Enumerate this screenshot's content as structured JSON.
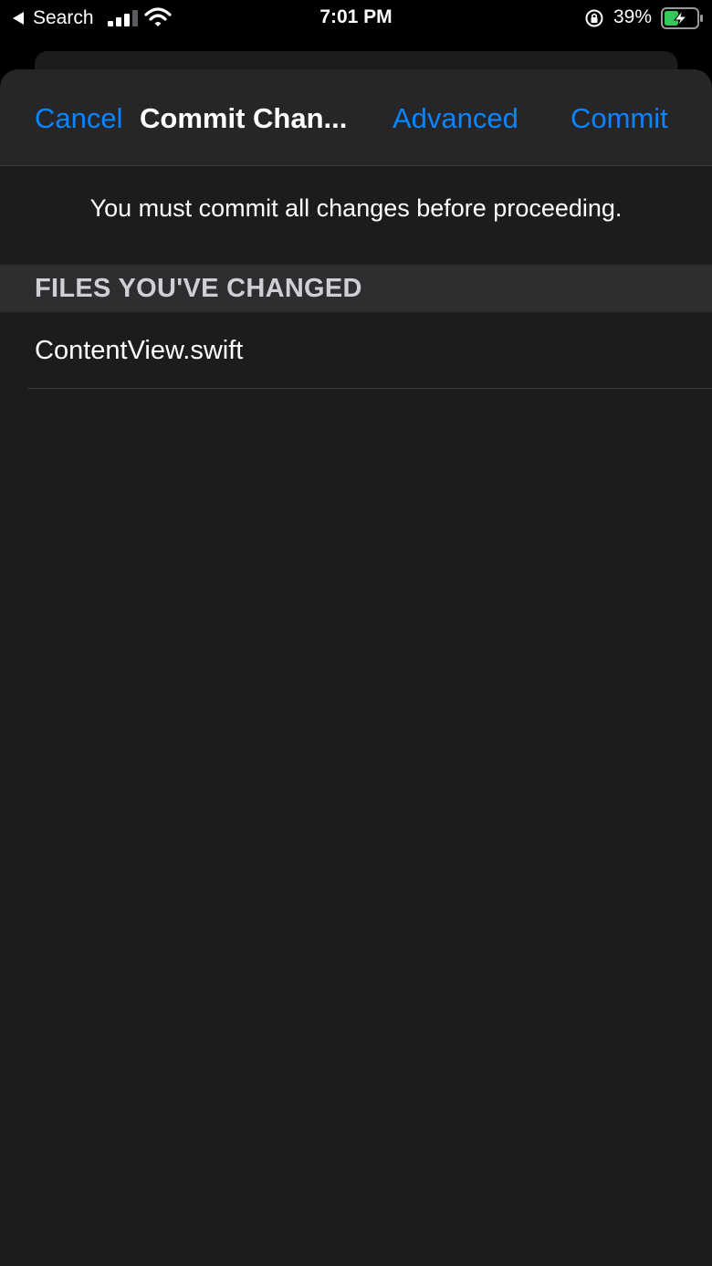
{
  "status_bar": {
    "back_label": "Search",
    "time": "7:01 PM",
    "battery_percent": "39%",
    "icons": [
      "back-triangle-icon",
      "cellular-signal-icon",
      "wifi-icon",
      "orientation-lock-icon",
      "battery-charging-icon"
    ]
  },
  "nav": {
    "cancel_label": "Cancel",
    "title": "Commit Chan...",
    "advanced_label": "Advanced",
    "commit_label": "Commit"
  },
  "message": "You must commit all changes before proceeding.",
  "section": {
    "header": "FILES YOU'VE CHANGED",
    "files": [
      "ContentView.swift"
    ]
  },
  "colors": {
    "accent": "#0a84ff",
    "background": "#1c1c1e",
    "nav_background": "#262628",
    "section_background": "#2e2e30",
    "battery_fill": "#34c759"
  }
}
